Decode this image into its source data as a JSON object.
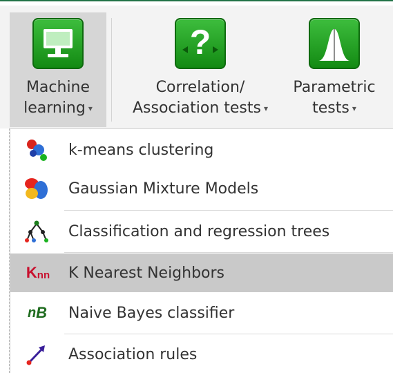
{
  "ribbon": {
    "machine_learning": {
      "line1": "Machine",
      "line2": "learning"
    },
    "correlation": {
      "line1": "Correlation/",
      "line2": "Association tests"
    },
    "parametric": {
      "line1": "Parametric",
      "line2": "tests"
    },
    "caret": "▾"
  },
  "menu": {
    "items": [
      {
        "label": "k-means clustering",
        "icon": "k-means-icon"
      },
      {
        "label": "Gaussian Mixture Models",
        "icon": "gaussian-mixture-icon"
      },
      {
        "label": "Classification and regression trees",
        "icon": "tree-icon"
      },
      {
        "label": "K Nearest Neighbors",
        "icon": "knn-icon",
        "icon_text_main": "K",
        "icon_text_sub": "nn",
        "highlighted": true
      },
      {
        "label": "Naive Bayes classifier",
        "icon": "naive-bayes-icon",
        "icon_text_main": "n",
        "icon_text_sub": "B"
      },
      {
        "label": "Association rules",
        "icon": "association-rules-icon"
      }
    ]
  },
  "colors": {
    "ribbon_icon_green": "#1f9a1f",
    "hover_bg": "#c9c9c9",
    "knn_red": "#c8102e",
    "nb_green": "#1e6b1e"
  }
}
